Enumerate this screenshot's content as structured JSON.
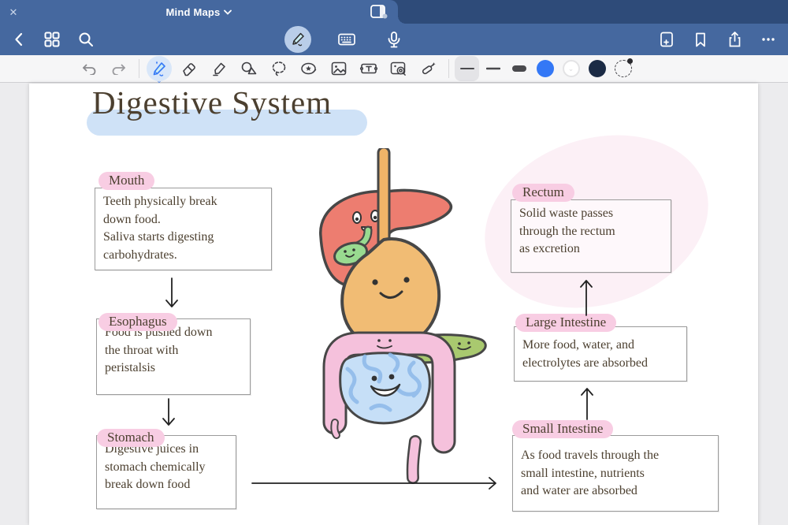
{
  "titlebar": {
    "close_label": "✕",
    "title": "Mind Maps"
  },
  "toolbar_icons": [
    "back",
    "grid-view",
    "search",
    "pen-mode",
    "keyboard",
    "microphone",
    "add-page",
    "bookmark",
    "share",
    "more"
  ],
  "tool_ribbon": {
    "tools": [
      "undo",
      "redo",
      "pen",
      "eraser",
      "highlighter",
      "shapes",
      "lasso",
      "stickers",
      "image",
      "text",
      "elements",
      "laser-pointer"
    ],
    "selected_tool": "pen",
    "thickness_options": [
      "thin",
      "medium",
      "thick"
    ],
    "selected_thickness": "thin",
    "color_swatches": [
      "#3478f6",
      "#ffffff",
      "#1b2b45"
    ],
    "selected_color": "#ffffff",
    "more_label": "…"
  },
  "colors": {
    "titlebar_bg": "#2e4b79",
    "navbar_bg": "#45689f",
    "ribbon_bg": "#f6f6f7",
    "page_bg": "#ffffff",
    "canvas_bg": "#ececee",
    "title_highlight": "#cfe2f7",
    "label_highlight": "#f8cde3",
    "ink": "#4c4030",
    "accent_blue": "#3478f6"
  },
  "map": {
    "title": "Digestive System",
    "nodes": [
      {
        "label": "Mouth",
        "body": "Teeth physically break\ndown food.\nSaliva starts digesting\ncarbohydrates."
      },
      {
        "label": "Esophagus",
        "body": "Food is pushed down\nthe throat with\nperistalsis"
      },
      {
        "label": "Stomach",
        "body": "Digestive juices in\nstomach chemically\nbreak down food"
      },
      {
        "label": "Small Intestine",
        "body": "As food travels through the\nsmall intestine, nutrients\nand water are absorbed"
      },
      {
        "label": "Large Intestine",
        "body": "More food, water, and\nelectrolytes are absorbed"
      },
      {
        "label": "Rectum",
        "body": "Solid waste passes\nthrough the rectum\nas excretion"
      }
    ],
    "connections": [
      "Mouth → Esophagus",
      "Esophagus → Stomach",
      "Stomach → Small Intestine",
      "Small Intestine → Large Intestine",
      "Large Intestine → Rectum"
    ],
    "illustration": "cartoon digestive system: liver, gallbladder, esophagus, stomach, pancreas, small intestine, large intestine, rectum"
  }
}
